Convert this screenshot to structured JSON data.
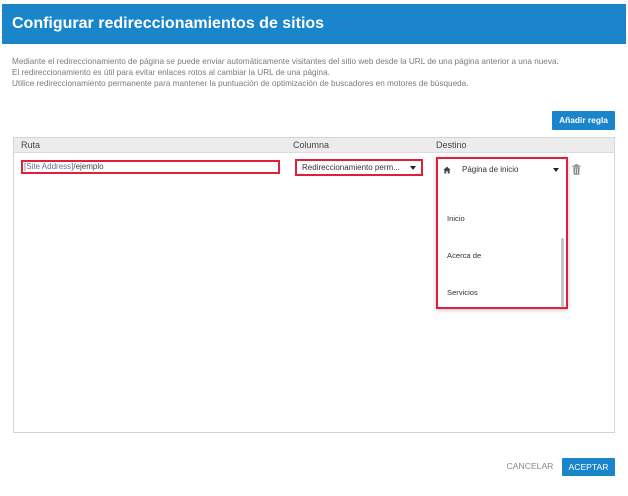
{
  "dialog": {
    "title": "Configurar redireccionamientos de sitios",
    "description": [
      "Mediante el redireccionamiento de página se puede enviar automáticamente visitantes del sitio web desde la URL de una página anterior a una nueva.",
      "El redireccionamiento es útil para evitar enlaces rotos al cambiar la URL de una página.",
      "Utilice redireccionamiento permanente para mantener la puntuación de optimización de buscadores en motores de búsqueda."
    ],
    "add_rule_label": "Añadir regla"
  },
  "table": {
    "headers": {
      "route": "Ruta",
      "column": "Columna",
      "destination": "Destino"
    },
    "row": {
      "path_tag": "[Site Address]",
      "path_value": "/ejemplo",
      "column_value": "Redireccionamiento perm...",
      "destination_value": "Página de inicio",
      "destination_options": [
        "Inicio",
        "Acerca de",
        "Servicios"
      ]
    }
  },
  "footer": {
    "cancel_label": "CANCELAR",
    "ok_label": "ACEPTAR"
  },
  "icons": {
    "home": "home-icon",
    "trash": "trash-icon",
    "caret": "chevron-down-icon"
  },
  "colors": {
    "accent": "#1b85cc",
    "highlight": "#e0203a"
  }
}
